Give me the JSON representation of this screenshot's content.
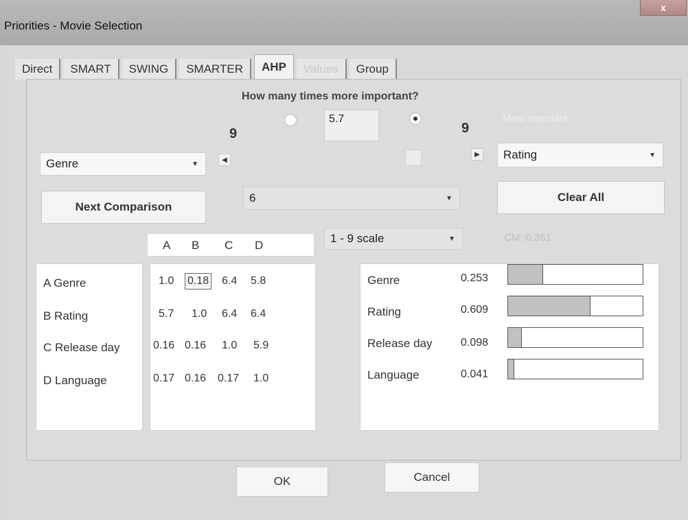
{
  "window": {
    "title": "Priorities - Movie Selection",
    "close_glyph": "x"
  },
  "tabs": [
    {
      "label": "Direct",
      "state": "normal"
    },
    {
      "label": "SMART",
      "state": "normal"
    },
    {
      "label": "SWING",
      "state": "normal"
    },
    {
      "label": "SMARTER",
      "state": "normal"
    },
    {
      "label": "AHP",
      "state": "active"
    },
    {
      "label": "Values",
      "state": "disabled"
    },
    {
      "label": "Group",
      "state": "normal"
    }
  ],
  "ahp": {
    "question": "How many times more important?",
    "ratio_value": "5.7",
    "left_scale_max": "9",
    "right_scale_max": "9",
    "more_important_label": "More important",
    "left_criterion": "Genre",
    "right_criterion": "Rating",
    "next_comparison_label": "Next Comparison",
    "clear_all_label": "Clear All",
    "comparison_select": "6",
    "scale_select": "1 - 9 scale",
    "cm_label": "CM: 0.351",
    "left_radio_selected": false,
    "right_radio_selected": true
  },
  "matrix": {
    "column_headers": [
      "A",
      "B",
      "C",
      "D"
    ],
    "row_labels": [
      "A Genre",
      "B Rating",
      "C Release day",
      "D Language"
    ],
    "rows": [
      [
        "1.0",
        "0.18",
        "6.4",
        "5.8"
      ],
      [
        "5.7",
        "1.0",
        "6.4",
        "6.4"
      ],
      [
        "0.16",
        "0.16",
        "1.0",
        "5.9"
      ],
      [
        "0.17",
        "0.16",
        "0.17",
        "1.0"
      ]
    ],
    "selected_cell": {
      "row": 0,
      "col": 1
    }
  },
  "weights": [
    {
      "name": "Genre",
      "value": "0.253",
      "fraction": 0.253
    },
    {
      "name": "Rating",
      "value": "0.609",
      "fraction": 0.609
    },
    {
      "name": "Release day",
      "value": "0.098",
      "fraction": 0.098
    },
    {
      "name": "Language",
      "value": "0.041",
      "fraction": 0.041
    }
  ],
  "dialog": {
    "ok_label": "OK",
    "cancel_label": "Cancel"
  }
}
